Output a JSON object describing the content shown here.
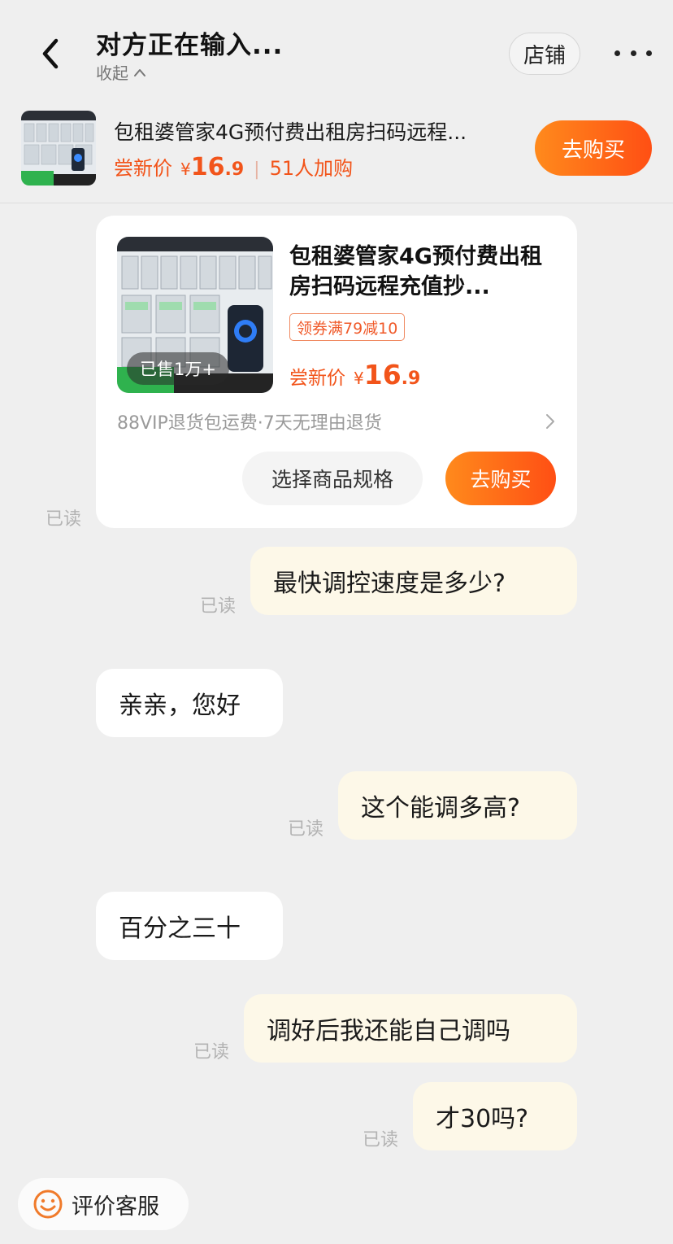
{
  "header": {
    "title": "对方正在输入...",
    "collapse_label": "收起",
    "store_label": "店铺"
  },
  "product_bar": {
    "title": "包租婆管家4G预付费出租房扫码远程...",
    "price_label": "尝新价",
    "currency": "¥",
    "price_int": "16",
    "price_dec": ".9",
    "added_count": "51人加购",
    "buy_label": "去购买"
  },
  "product_card": {
    "title": "包租婆管家4G预付费出租房扫码远程充值抄...",
    "sold_badge": "已售1万+",
    "coupon": "领券满79减10",
    "price_label": "尝新价",
    "currency": "¥",
    "price_int": "16",
    "price_dec": ".9",
    "service": "88VIP退货包运费·7天无理由退货",
    "spec_label": "选择商品规格",
    "buy_label": "去购买"
  },
  "messages": [
    {
      "direction": "out",
      "text": "最快调控速度是多少?",
      "read": "已读"
    },
    {
      "direction": "in",
      "text": "亲亲，您好"
    },
    {
      "direction": "out",
      "text": "这个能调多高?",
      "read": "已读"
    },
    {
      "direction": "in",
      "text": "百分之三十"
    },
    {
      "direction": "out",
      "text": "调好后我还能自己调吗",
      "read": "已读"
    },
    {
      "direction": "out",
      "text": "才30吗?",
      "read": "已读"
    }
  ],
  "card_read": "已读",
  "rate_service_label": "评价客服",
  "colors": {
    "accent": "#f2541a",
    "button_gradient_start": "#ff8a1c",
    "button_gradient_end": "#ff4f14",
    "outgoing_bubble": "#fdf8e8",
    "background": "#efefef"
  },
  "icons": [
    "back-arrow-icon",
    "chevron-up-icon",
    "more-dots-icon",
    "chevron-right-icon",
    "smiley-icon"
  ]
}
